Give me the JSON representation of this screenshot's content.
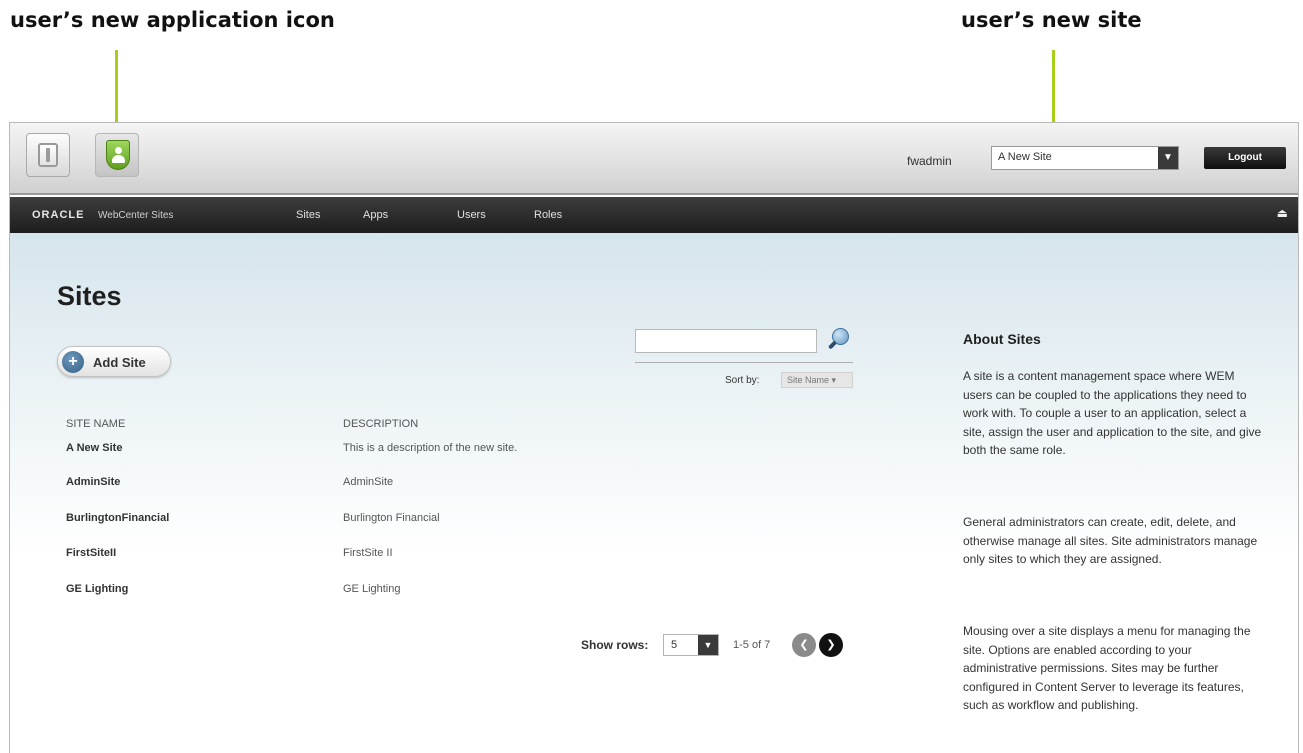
{
  "annotations": {
    "app_icon_callout": "user’s new application icon",
    "site_callout": "user’s new site"
  },
  "colors": {
    "callout_line": "#a6ce1a",
    "nav_background": "#2a2a2a",
    "content_gradient_top": "#d6e5ec"
  },
  "header": {
    "app_icons": [
      {
        "icon": "document-app-icon"
      },
      {
        "icon": "shield-user-app-icon"
      }
    ],
    "username": "fwadmin",
    "site_select": {
      "value": "A New Site"
    },
    "logout_label": "Logout"
  },
  "nav": {
    "logo": "ORACLE",
    "product": "WebCenter Sites",
    "items": [
      "Sites",
      "Apps",
      "Users",
      "Roles"
    ],
    "eject_icon": "eject-icon"
  },
  "main": {
    "title": "Sites",
    "add_site_label": "Add Site",
    "search": {
      "value": ""
    },
    "sort_label": "Sort by:",
    "sort_value": "Site Name",
    "columns": [
      "SITE NAME",
      "DESCRIPTION"
    ],
    "rows": [
      {
        "name": "A New Site",
        "description": "This is a description of the new site."
      },
      {
        "name": "AdminSite",
        "description": "AdminSite"
      },
      {
        "name": "BurlingtonFinancial",
        "description": "Burlington Financial"
      },
      {
        "name": "FirstSiteII",
        "description": "FirstSite II"
      },
      {
        "name": "GE Lighting",
        "description": "GE Lighting"
      }
    ],
    "pagination": {
      "show_rows_label": "Show rows:",
      "rows_value": "5",
      "page_info": "1-5 of 7"
    }
  },
  "about": {
    "title": "About Sites",
    "paragraphs": [
      "A site is a content management space where WEM users can be coupled to the applications they need to work with. To couple a user to an application, select a site, assign the user and application to the site, and give both the same role.",
      "General administrators can create, edit, delete, and otherwise manage all sites. Site administrators manage only sites to which they are assigned.",
      "Mousing over a site displays a menu for managing the site. Options are enabled according to your administrative permissions. Sites may be further configured in Content Server to leverage its features, such as workflow and publishing."
    ]
  }
}
